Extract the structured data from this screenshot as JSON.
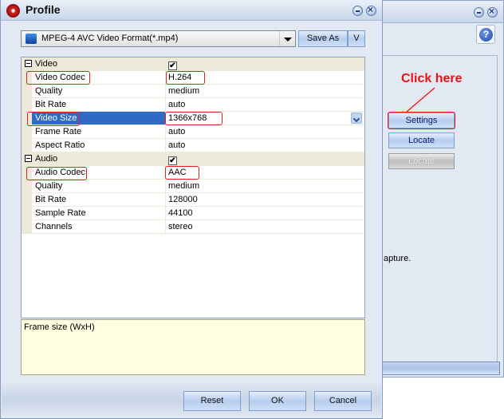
{
  "background_window": {
    "help_label": "?",
    "annotation": "Click here",
    "buttons": [
      {
        "label": "Settings",
        "enabled": true
      },
      {
        "label": "Locate",
        "enabled": true
      },
      {
        "label": "Locate",
        "enabled": false
      }
    ],
    "partial_text": "apture."
  },
  "dialog": {
    "title": "Profile",
    "format_selector": {
      "value": "MPEG-4 AVC Video Format(*.mp4)"
    },
    "save_as_label": "Save As",
    "v_label": "V",
    "properties": {
      "video": {
        "label": "Video",
        "checked": "✔",
        "rows": [
          {
            "key": "Video Codec",
            "value": "H.264"
          },
          {
            "key": "Quality",
            "value": "medium"
          },
          {
            "key": "Bit Rate",
            "value": "auto"
          },
          {
            "key": "Video Size",
            "value": "1366x768"
          },
          {
            "key": "Frame Rate",
            "value": "auto"
          },
          {
            "key": "Aspect Ratio",
            "value": "auto"
          }
        ]
      },
      "audio": {
        "label": "Audio",
        "checked": "✔",
        "rows": [
          {
            "key": "Audio Codec",
            "value": "AAC"
          },
          {
            "key": "Quality",
            "value": "medium"
          },
          {
            "key": "Bit Rate",
            "value": "128000"
          },
          {
            "key": "Sample Rate",
            "value": "44100"
          },
          {
            "key": "Channels",
            "value": "stereo"
          }
        ]
      }
    },
    "description": "Frame size (WxH)",
    "footer": {
      "reset": "Reset",
      "ok": "OK",
      "cancel": "Cancel"
    }
  }
}
